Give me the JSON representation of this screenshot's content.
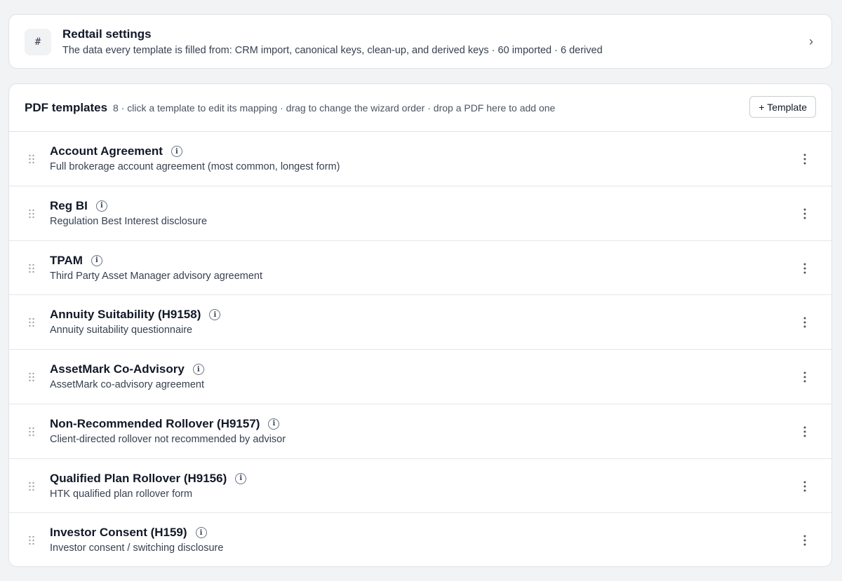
{
  "settings": {
    "icon": "hash-icon",
    "icon_glyph": "#",
    "title": "Redtail settings",
    "subtitle": "The data every template is filled from: CRM import, canonical keys, clean-up, and derived keys · 60 imported · 6 derived",
    "chevron": "›"
  },
  "templates": {
    "title": "PDF templates",
    "hint": "8 · click a template to edit its mapping · drag to change the wizard order · drop a PDF here to add one",
    "add_button": "+ Template",
    "items": [
      {
        "name": "Account Agreement",
        "description": "Full brokerage account agreement (most common, longest form)"
      },
      {
        "name": "Reg BI",
        "description": "Regulation Best Interest disclosure"
      },
      {
        "name": "TPAM",
        "description": "Third Party Asset Manager advisory agreement"
      },
      {
        "name": "Annuity Suitability (H9158)",
        "description": "Annuity suitability questionnaire"
      },
      {
        "name": "AssetMark Co-Advisory",
        "description": "AssetMark co-advisory agreement"
      },
      {
        "name": "Non-Recommended Rollover (H9157)",
        "description": "Client-directed rollover not recommended by advisor"
      },
      {
        "name": "Qualified Plan Rollover (H9156)",
        "description": "HTK qualified plan rollover form"
      },
      {
        "name": "Investor Consent (H159)",
        "description": "Investor consent / switching disclosure"
      }
    ]
  },
  "icons": {
    "info_glyph": "i"
  },
  "colors": {
    "background": "#f2f3f5",
    "card": "#ffffff",
    "border": "#dfe2e7",
    "text_primary": "#111827",
    "text_secondary": "#374151"
  }
}
